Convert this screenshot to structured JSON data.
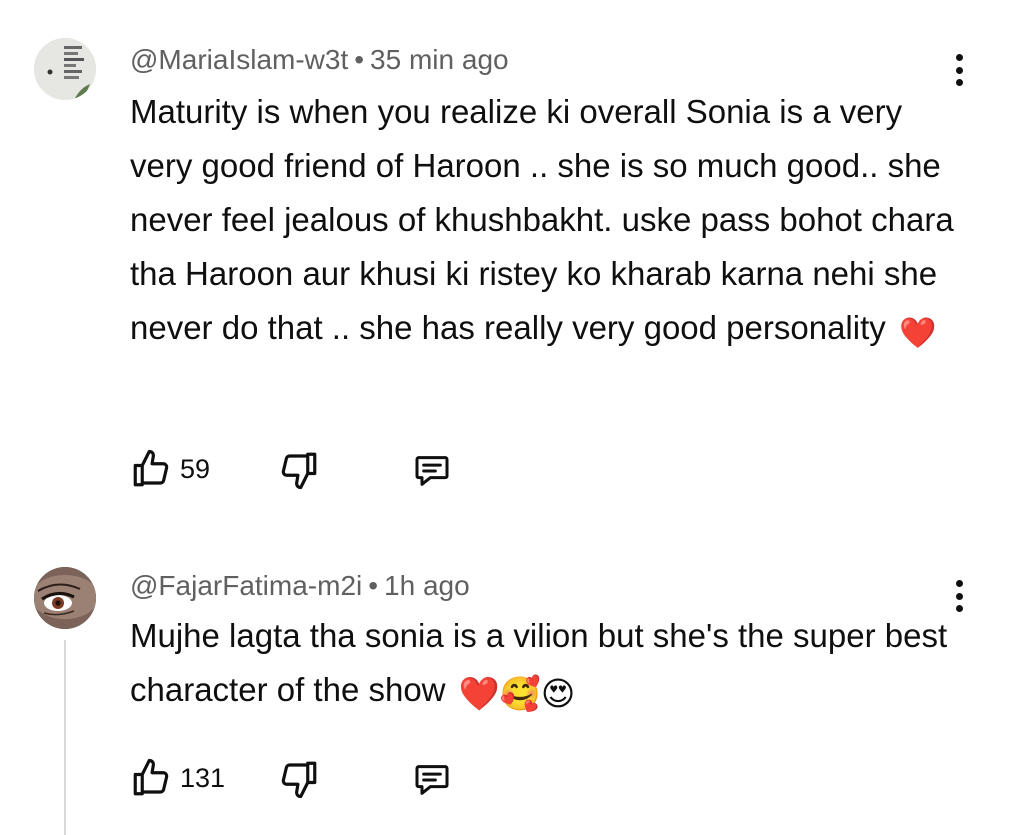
{
  "comments": [
    {
      "handle": "@MariaIslam-w3t",
      "time": "35 min ago",
      "text": "Maturity is when you realize ki overall Sonia is a very very good friend of Haroon .. she is so much good.. she never feel jealous of khushbakht. uske pass bohot chara tha Haroon aur khusi ki ristey ko kharab karna nehi she never do that .. she has really very good personality",
      "emoji": "❤️",
      "likes": "59"
    },
    {
      "handle": "@FajarFatima-m2i",
      "time": "1h ago",
      "text": "Mujhe lagta tha sonia is a vilion but she's the super best character of the show",
      "emoji": "❤️🥰😍",
      "likes": "131"
    }
  ],
  "separator": "•",
  "icons": {
    "like": "thumbs-up-icon",
    "dislike": "thumbs-down-icon",
    "reply": "comment-reply-icon",
    "more": "more-vert-icon"
  },
  "colors": {
    "text": "#0f0f0f",
    "meta": "#606060",
    "heart": "#e0245e",
    "thread_line": "#d8d8d8"
  }
}
